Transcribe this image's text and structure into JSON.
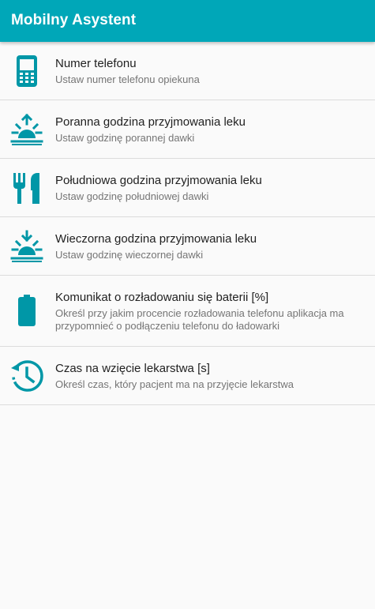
{
  "app": {
    "title": "Mobilny Asystent",
    "accent_color": "#00a7b8",
    "icon_color": "#0097a7"
  },
  "settings": [
    {
      "icon": "phone-icon",
      "title": "Numer telefonu",
      "subtitle": "Ustaw numer telefonu opiekuna"
    },
    {
      "icon": "sunrise-icon",
      "title": "Poranna godzina przyjmowania leku",
      "subtitle": "Ustaw godzinę porannej dawki"
    },
    {
      "icon": "fork-knife-icon",
      "title": "Południowa godzina przyjmowania leku",
      "subtitle": "Ustaw godzinę południowej dawki"
    },
    {
      "icon": "sunset-icon",
      "title": "Wieczorna godzina przyjmowania leku",
      "subtitle": "Ustaw godzinę wieczornej dawki"
    },
    {
      "icon": "battery-icon",
      "title": "Komunikat o rozładowaniu się baterii [%]",
      "subtitle": "Określ przy jakim procencie rozładowania telefonu aplikacja ma przypomnieć o podłączeniu telefonu do ładowarki"
    },
    {
      "icon": "timer-icon",
      "title": "Czas na wzięcie lekarstwa [s]",
      "subtitle": "Określ czas, który pacjent ma na przyjęcie lekarstwa"
    }
  ]
}
